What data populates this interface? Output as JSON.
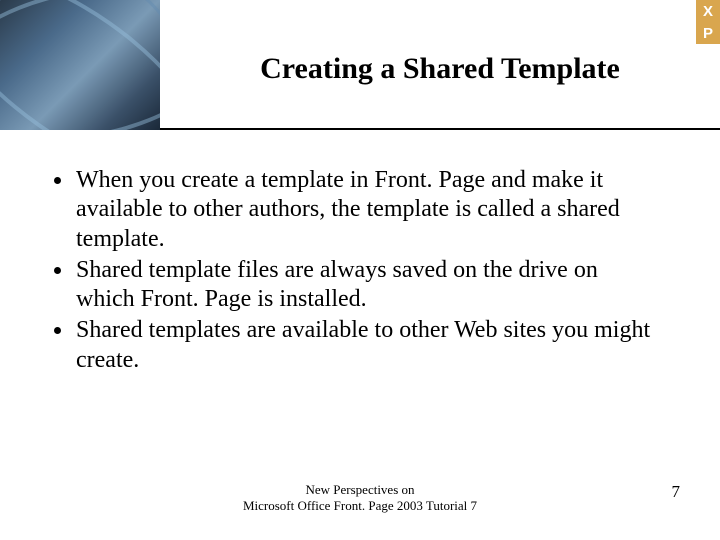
{
  "badge": {
    "line1": "X",
    "line2": "P"
  },
  "slide": {
    "title": "Creating a Shared Template",
    "bullets": [
      "When you create a template in Front. Page and make it available to other authors, the template is called a shared template.",
      "Shared template files are always saved on the drive on which Front. Page is installed.",
      "Shared templates are available to other Web sites you might create."
    ]
  },
  "footer": {
    "line1": "New Perspectives on",
    "line2": "Microsoft Office Front. Page 2003 Tutorial 7",
    "page": "7"
  }
}
